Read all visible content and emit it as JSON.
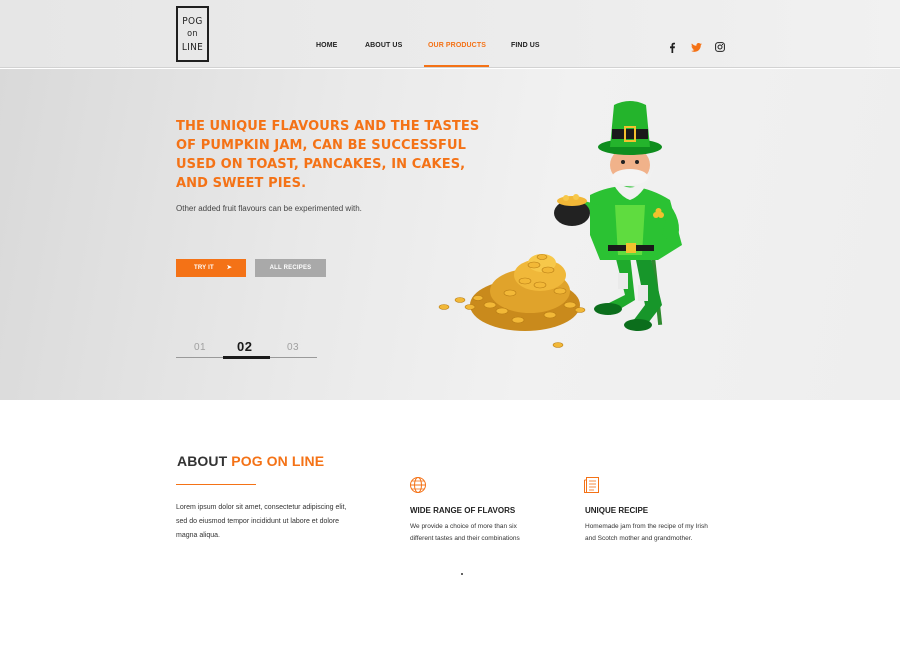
{
  "brand": {
    "logo_line1": "POG",
    "logo_line2": "on",
    "logo_line3": "LINE",
    "accent_color": "#f47216"
  },
  "nav": {
    "items": [
      {
        "label": "HOME",
        "active": false
      },
      {
        "label": "ABOUT US",
        "active": false
      },
      {
        "label": "OUR PRODUCTS",
        "active": true
      },
      {
        "label": "FIND US",
        "active": false
      }
    ]
  },
  "social": {
    "icons": [
      "facebook-icon",
      "twitter-icon",
      "instagram-icon"
    ]
  },
  "hero": {
    "title": "THE UNIQUE FLAVOURS AND THE TASTES OF PUMPKIN JAM, CAN BE SUCCESSFUL USED ON TOAST, PANCAKES, IN CAKES, AND SWEET PIES.",
    "subtitle": "Other added fruit flavours can be experimented with.",
    "try_button": "TRY IT",
    "try_arrow": "➤",
    "recipes_button": "ALL RECIPES",
    "slides": [
      "01",
      "02",
      "03"
    ],
    "active_slide": "02"
  },
  "about": {
    "title_prefix": "ABOUT ",
    "title_highlight": "POG ON LINE",
    "text": "Lorem ipsum dolor sit amet, consectetur adipiscing elit, sed do eiusmod tempor incididunt ut labore et dolore magna aliqua.",
    "features": [
      {
        "icon": "globe-icon",
        "title": "WIDE RANGE OF FLAVORS",
        "text": "We provide a choice of more than six different tastes and their combinations"
      },
      {
        "icon": "recipe-document-icon",
        "title": "UNIQUE RECIPE",
        "text": "Homemade jam from the recipe of my Irish and Scotch mother and grandmother."
      }
    ]
  }
}
